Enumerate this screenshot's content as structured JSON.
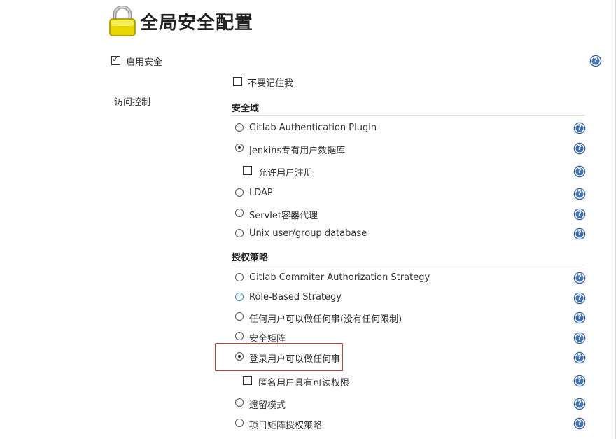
{
  "page": {
    "title": "全局安全配置",
    "enable_security_label": "启用安全",
    "access_control_label": "访问控制"
  },
  "options": {
    "remember_me_label": "不要记住我",
    "security_realm": {
      "heading": "安全域",
      "items": [
        {
          "label": "Gitlab Authentication Plugin",
          "selected": false
        },
        {
          "label": "Jenkins专有用户数据库",
          "selected": true
        },
        {
          "label": "LDAP",
          "selected": false
        },
        {
          "label": "Servlet容器代理",
          "selected": false
        },
        {
          "label": "Unix user/group database",
          "selected": false
        }
      ],
      "allow_signup_label": "允许用户注册"
    },
    "authorization": {
      "heading": "授权策略",
      "items": [
        {
          "label": "Gitlab Commiter Authorization Strategy",
          "selected": false
        },
        {
          "label": "Role-Based Strategy",
          "selected": false
        },
        {
          "label": "任何用户可以做任何事(没有任何限制)",
          "selected": false
        },
        {
          "label": "安全矩阵",
          "selected": false
        },
        {
          "label": "登录用户可以做任何事",
          "selected": true
        },
        {
          "label": "遗留模式",
          "selected": false
        },
        {
          "label": "项目矩阵授权策略",
          "selected": false
        }
      ],
      "anonymous_read_label": "匿名用户具有可读权限"
    }
  },
  "help_icon_glyph": "?",
  "colors": {
    "help_icon": "#3e71b8",
    "highlight_border": "#d23a3a",
    "radio_blue": "#3b8fd8"
  }
}
